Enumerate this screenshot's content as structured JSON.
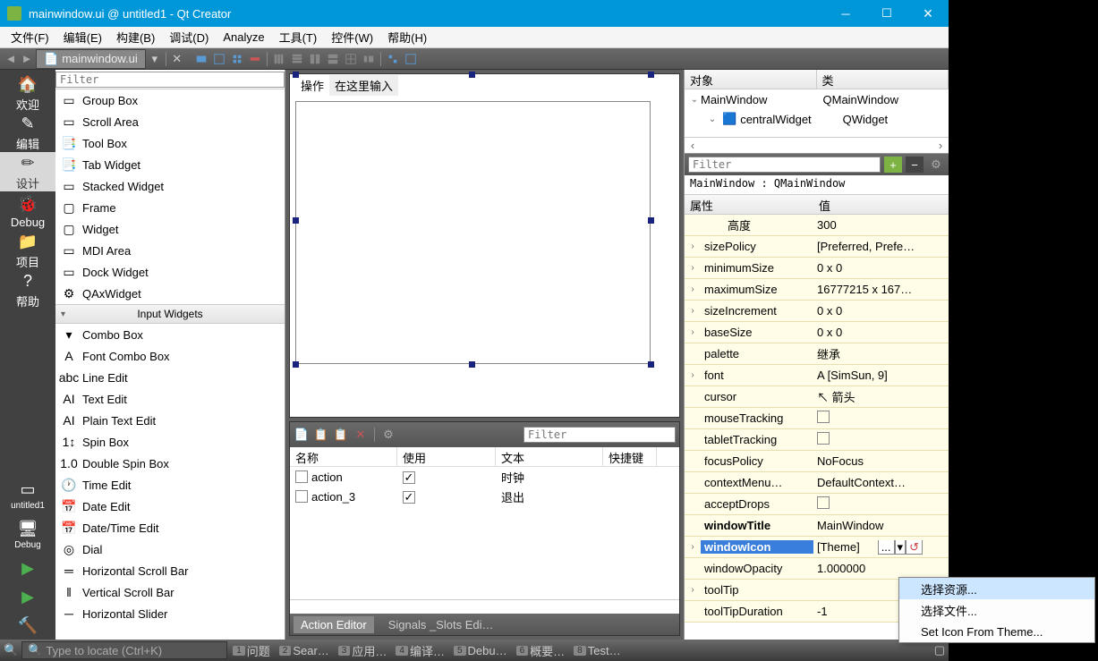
{
  "titlebar": {
    "text": "mainwindow.ui @ untitled1 - Qt Creator"
  },
  "menus": [
    "文件(F)",
    "编辑(E)",
    "构建(B)",
    "调试(D)",
    "Analyze",
    "工具(T)",
    "控件(W)",
    "帮助(H)"
  ],
  "toolbar_tab": "mainwindow.ui",
  "sidebar": [
    {
      "label": "欢迎",
      "icon": "🏠"
    },
    {
      "label": "编辑",
      "icon": "✎"
    },
    {
      "label": "设计",
      "icon": "✏",
      "active": true
    },
    {
      "label": "Debug",
      "icon": "🐞"
    },
    {
      "label": "项目",
      "icon": "📁"
    },
    {
      "label": "帮助",
      "icon": "?"
    }
  ],
  "sidebar_bottom": [
    {
      "label": "untitled1",
      "icon": "▭"
    },
    {
      "label": "Debug",
      "icon": "🖥"
    }
  ],
  "sidebar_run": [
    "▶",
    "▶",
    "🔨"
  ],
  "filter_placeholder": "Filter",
  "widget_items_top": [
    {
      "label": "Group Box",
      "icon": "▭"
    },
    {
      "label": "Scroll Area",
      "icon": "▭"
    },
    {
      "label": "Tool Box",
      "icon": "📑"
    },
    {
      "label": "Tab Widget",
      "icon": "📑"
    },
    {
      "label": "Stacked Widget",
      "icon": "▭"
    },
    {
      "label": "Frame",
      "icon": "▢"
    },
    {
      "label": "Widget",
      "icon": "▢"
    },
    {
      "label": "MDI Area",
      "icon": "▭"
    },
    {
      "label": "Dock Widget",
      "icon": "▭"
    },
    {
      "label": "QAxWidget",
      "icon": "⚙"
    }
  ],
  "widget_category": "Input Widgets",
  "widget_items_bottom": [
    {
      "label": "Combo Box",
      "icon": "▾"
    },
    {
      "label": "Font Combo Box",
      "icon": "A"
    },
    {
      "label": "Line Edit",
      "icon": "abc"
    },
    {
      "label": "Text Edit",
      "icon": "AI"
    },
    {
      "label": "Plain Text Edit",
      "icon": "AI"
    },
    {
      "label": "Spin Box",
      "icon": "1↕"
    },
    {
      "label": "Double Spin Box",
      "icon": "1.0"
    },
    {
      "label": "Time Edit",
      "icon": "🕐"
    },
    {
      "label": "Date Edit",
      "icon": "📅"
    },
    {
      "label": "Date/Time Edit",
      "icon": "📅"
    },
    {
      "label": "Dial",
      "icon": "◎"
    },
    {
      "label": "Horizontal Scroll Bar",
      "icon": "═"
    },
    {
      "label": "Vertical Scroll Bar",
      "icon": "‖"
    },
    {
      "label": "Horizontal Slider",
      "icon": "─"
    }
  ],
  "canvas": {
    "action_label": "操作",
    "input_label": "在这里输入"
  },
  "action": {
    "filter_placeholder": "Filter",
    "headers": [
      "名称",
      "使用",
      "文本",
      "快捷键"
    ],
    "rows": [
      {
        "name": "action",
        "used": true,
        "text": "时钟"
      },
      {
        "name": "action_3",
        "used": true,
        "text": "退出"
      }
    ],
    "tabs": [
      "Action Editor",
      "Signals _Slots Edi…"
    ]
  },
  "obj_tree": {
    "headers": [
      "对象",
      "类"
    ],
    "rows": [
      {
        "name": "MainWindow",
        "cls": "QMainWindow",
        "depth": 0
      },
      {
        "name": "centralWidget",
        "cls": "QWidget",
        "depth": 1
      }
    ]
  },
  "props": {
    "filter_placeholder": "Filter",
    "crumb": "MainWindow : QMainWindow",
    "headers": [
      "属性",
      "值"
    ],
    "rows": [
      {
        "n": "高度",
        "v": "300",
        "indent": true
      },
      {
        "n": "sizePolicy",
        "v": "[Preferred, Prefe…",
        "exp": true
      },
      {
        "n": "minimumSize",
        "v": "0 x 0",
        "exp": true
      },
      {
        "n": "maximumSize",
        "v": "16777215 x 167…",
        "exp": true
      },
      {
        "n": "sizeIncrement",
        "v": "0 x 0",
        "exp": true
      },
      {
        "n": "baseSize",
        "v": "0 x 0",
        "exp": true
      },
      {
        "n": "palette",
        "v": "继承"
      },
      {
        "n": "font",
        "v": "A  [SimSun, 9]",
        "exp": true
      },
      {
        "n": "cursor",
        "v": "↖  箭头"
      },
      {
        "n": "mouseTracking",
        "v": "",
        "chk": true
      },
      {
        "n": "tabletTracking",
        "v": "",
        "chk": true
      },
      {
        "n": "focusPolicy",
        "v": "NoFocus"
      },
      {
        "n": "contextMenu…",
        "v": "DefaultContext…"
      },
      {
        "n": "acceptDrops",
        "v": "",
        "chk": true
      },
      {
        "n": "windowTitle",
        "v": "MainWindow",
        "bold": true
      },
      {
        "n": "windowIcon",
        "v": "[Theme]",
        "exp": true,
        "sel": true,
        "editor": true
      },
      {
        "n": "windowOpacity",
        "v": "1.000000"
      },
      {
        "n": "toolTip",
        "v": "",
        "exp": true
      },
      {
        "n": "toolTipDuration",
        "v": "-1"
      }
    ]
  },
  "status": {
    "locate_placeholder": "Type to locate (Ctrl+K)",
    "items": [
      {
        "n": "1",
        "t": "问题"
      },
      {
        "n": "2",
        "t": "Sear…"
      },
      {
        "n": "3",
        "t": "应用…"
      },
      {
        "n": "4",
        "t": "编译…"
      },
      {
        "n": "5",
        "t": "Debu…"
      },
      {
        "n": "6",
        "t": "概要…"
      },
      {
        "n": "8",
        "t": "Test…"
      }
    ]
  },
  "context_menu": [
    "选择资源...",
    "选择文件...",
    "Set Icon From Theme..."
  ]
}
